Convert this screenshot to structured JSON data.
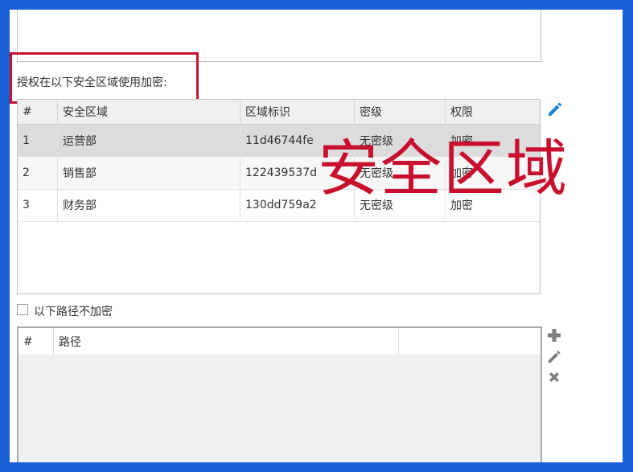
{
  "auth_label": "授权在以下安全区域使用加密:",
  "zones": {
    "headers": [
      "#",
      "安全区域",
      "区域标识",
      "密级",
      "权限"
    ],
    "rows": [
      {
        "num": "1",
        "zone": "运营部",
        "id": "11d46744fe",
        "level": "无密级",
        "perm": "加密",
        "selected": true
      },
      {
        "num": "2",
        "zone": "销售部",
        "id": "122439537d",
        "level": "无密级",
        "perm": "加密",
        "selected": false
      },
      {
        "num": "3",
        "zone": "财务部",
        "id": "130dd759a2",
        "level": "无密级",
        "perm": "加密",
        "selected": false
      }
    ]
  },
  "overlay_title": "安全区域",
  "exclude_paths": {
    "checkbox_label": "以下路径不加密",
    "checked": false,
    "headers": [
      "#",
      "路径"
    ]
  },
  "icons": {
    "zone_edit": "pencil-icon",
    "path_add": "plus-icon",
    "path_edit": "pencil-icon",
    "path_delete": "close-icon"
  },
  "colors": {
    "frame_border": "#1a5fd6",
    "highlight": "#c8102e",
    "accent_icon": "#1e7fd8",
    "grey_icon": "#7d7d7d",
    "selected_row": "#dcdcdc"
  }
}
